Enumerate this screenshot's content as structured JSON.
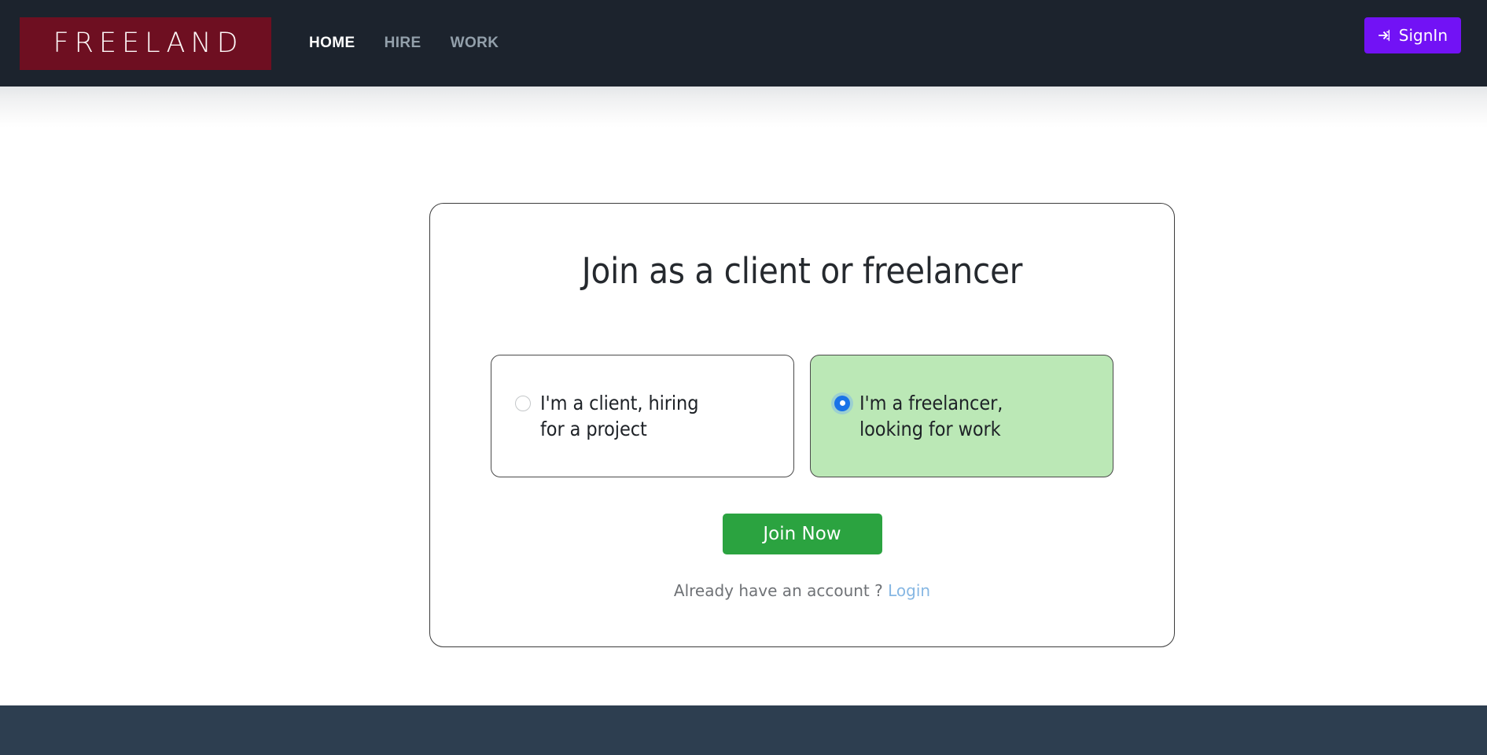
{
  "header": {
    "logo_text": "FREELAND",
    "nav": [
      {
        "label": "HOME",
        "active": true
      },
      {
        "label": "HIRE",
        "active": false
      },
      {
        "label": "WORK",
        "active": false
      }
    ],
    "signin_label": "SignIn",
    "signin_icon": "sign-in-arrow-icon",
    "background_color": "#1c232d",
    "logo_background_color": "#6e0f21",
    "signin_color": "#7212f5"
  },
  "main": {
    "card": {
      "title": "Join as a client or freelancer",
      "options": [
        {
          "id": "client",
          "label": "I'm a client, hiring for a project",
          "line1": "I'm a client, hiring",
          "line2": "for a project",
          "selected": false
        },
        {
          "id": "freelancer",
          "label": "I'm a freelancer, looking for work",
          "line1": "I'm a freelancer,",
          "line2": "looking for work",
          "selected": true,
          "selected_background_color": "#bbe8b6",
          "radio_color": "#1a73e8"
        }
      ],
      "join_button_label": "Join Now",
      "join_button_color": "#2ba340",
      "login_prompt": "Already have an account ?",
      "login_link_label": "Login",
      "login_link_color": "#86b7e3"
    }
  },
  "footer": {
    "background_color": "#2d3e50"
  }
}
